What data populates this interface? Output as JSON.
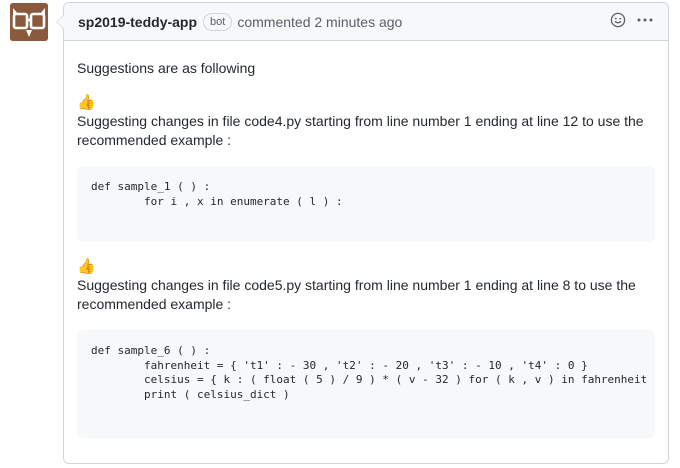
{
  "comment": {
    "author": "sp2019-teddy-app",
    "badge": "bot",
    "meta": "commented 2 minutes ago",
    "intro": "Suggestions are as following",
    "emoji_icon": "thumbs-up-icon"
  },
  "suggestions": [
    {
      "emoji": "👍",
      "text": "Suggesting changes in file code4.py starting from line number 1 ending at line 12 to use the recommended example :",
      "code": "def sample_1 ( ) :\n        for i , x in enumerate ( l ) :"
    },
    {
      "emoji": "👍",
      "text": "Suggesting changes in file code5.py starting from line number 1 ending at line 8 to use the recommended example :",
      "code": "def sample_6 ( ) :\n        fahrenheit = { 't1' : - 30 , 't2' : - 20 , 't3' : - 10 , 't4' : 0 }\n        celsius = { k : ( float ( 5 ) / 9 ) * ( v - 32 ) for ( k , v ) in fahrenheit .\n        print ( celsius_dict )"
    }
  ],
  "colors": {
    "avatar_bg": "#8b5a3c",
    "header_bg": "#f6f8fa",
    "border": "#d1d5da"
  }
}
